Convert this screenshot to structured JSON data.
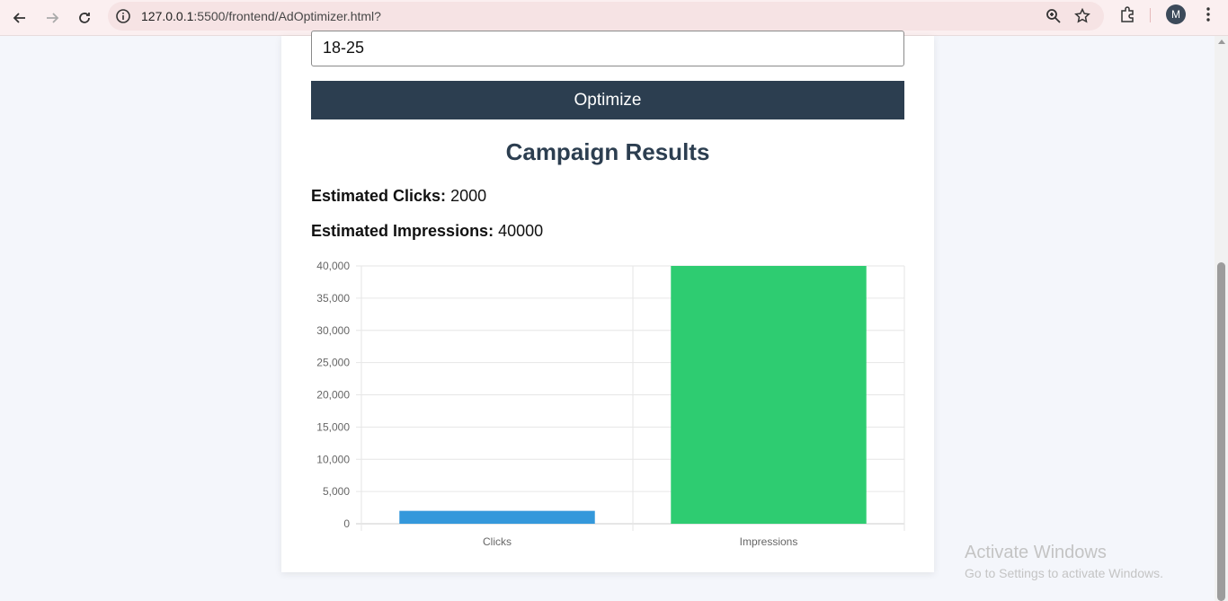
{
  "browser": {
    "url_host": "127.0.0.1",
    "url_path": ":5500/frontend/AdOptimizer.html?",
    "avatar_letter": "M"
  },
  "form": {
    "age_value": "18-25",
    "optimize_label": "Optimize"
  },
  "results": {
    "title": "Campaign Results",
    "clicks_label": "Estimated Clicks:",
    "clicks_value": "2000",
    "impressions_label": "Estimated Impressions:",
    "impressions_value": "40000"
  },
  "chart_data": {
    "type": "bar",
    "categories": [
      "Clicks",
      "Impressions"
    ],
    "values": [
      2000,
      40000
    ],
    "colors": [
      "#3498db",
      "#2ecc71"
    ],
    "ylim": [
      0,
      40000
    ],
    "yticks": [
      "40,000",
      "35,000",
      "30,000",
      "25,000",
      "20,000",
      "15,000",
      "10,000",
      "5,000",
      "0"
    ],
    "grid": true
  },
  "watermark": {
    "line1": "Activate Windows",
    "line2": "Go to Settings to activate Windows."
  }
}
